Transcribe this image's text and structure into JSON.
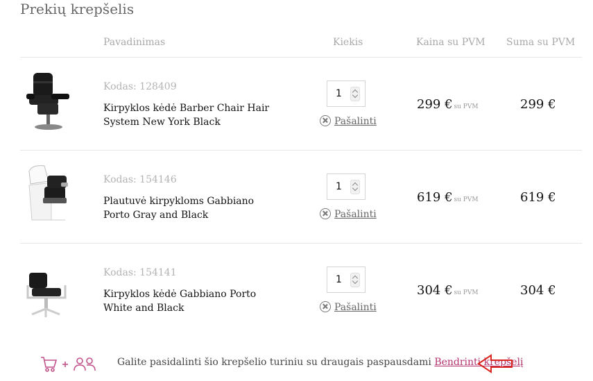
{
  "page_title": "Prekių krepšelis",
  "table_headers": {
    "name": "Pavadinimas",
    "quantity": "Kiekis",
    "price": "Kaina su PVM",
    "sum": "Suma su PVM"
  },
  "items": [
    {
      "code": "Kodas: 128409",
      "name": "Kirpyklos kėdė Barber Chair Hair System New York Black",
      "quantity": "1",
      "remove_label": "Pašalinti",
      "price": "299 €",
      "vat_note": "su PVM",
      "sum": "299 €",
      "image_icon": "barber-chair-black"
    },
    {
      "code": "Kodas: 154146",
      "name": "Plautuvė kirpykloms Gabbiano Porto Gray and Black",
      "quantity": "1",
      "remove_label": "Pašalinti",
      "price": "619 €",
      "vat_note": "su PVM",
      "sum": "619 €",
      "image_icon": "wash-basin-unit"
    },
    {
      "code": "Kodas: 154141",
      "name": "Kirpyklos kėdė Gabbiano Porto White and Black",
      "quantity": "1",
      "remove_label": "Pašalinti",
      "price": "304 €",
      "vat_note": "su PVM",
      "sum": "304 €",
      "image_icon": "styling-chair-white-black"
    }
  ],
  "share": {
    "text": "Galite pasidalinti šio krepšelio turiniu su draugais paspausdami",
    "link_label": "Bendrinti krepšelį",
    "icon_color": "#c2518a",
    "arrow_color": "#d9251d"
  }
}
